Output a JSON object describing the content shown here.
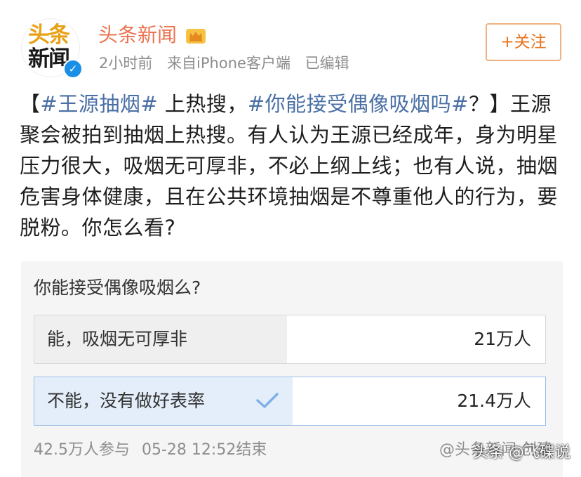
{
  "header": {
    "avatar_line1": "头条",
    "avatar_line2": "新闻",
    "username": "头条新闻",
    "time": "2小时前",
    "via": "来自iPhone客户端",
    "edited": "已编辑",
    "follow_label": "+关注"
  },
  "post": {
    "open": "【",
    "tag1": "#王源抽烟#",
    "mid1": " 上热搜，",
    "tag2": "#你能接受偶像吸烟吗#",
    "rest": "？】王源聚会被拍到抽烟上热搜。有人认为王源已经成年，身为明星压力很大，吸烟无可厚非，不必上纲上线；也有人说，抽烟危害身体健康，且在公共环境抽烟是不尊重他人的行为，要脱粉。你怎么看?"
  },
  "poll": {
    "question": "你能接受偶像吸烟么?",
    "options": [
      {
        "label": "能，吸烟无可厚非",
        "count": "21万人",
        "share": 0.495,
        "selected": false
      },
      {
        "label": "不能，没有做好表率",
        "count": "21.4万人",
        "share": 0.505,
        "selected": true
      }
    ],
    "participants": "42.5万人参与",
    "end_time": "05-28 12:52结束",
    "source": "@头条新闻 创建"
  },
  "watermark": "头条 @飞碟说",
  "icons": {
    "verified": "verified-badge-icon",
    "crown": "crown-icon",
    "check": "checkmark-icon"
  },
  "colors": {
    "username": "#eb7350",
    "tag": "#4a6fa5",
    "follow": "#e8761d",
    "verified": "#1a8fe8",
    "selected_fill": "#e4eefa"
  }
}
